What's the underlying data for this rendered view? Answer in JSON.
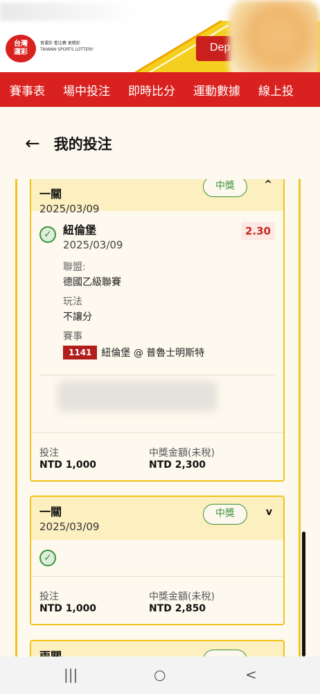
{
  "header": {
    "logo_text": "台灣\n運彩",
    "logo_tagline": "買運彩 看比賽 更精彩\nTAIWAN SPORTS LOTTERY",
    "deposit_label": "Dep"
  },
  "nav": [
    "賽事表",
    "場中投注",
    "即時比分",
    "運動數據",
    "線上投"
  ],
  "page": {
    "back": "←",
    "title": "我的投注"
  },
  "bets": [
    {
      "type": "一關",
      "date": "2025/03/09",
      "status": "中獎",
      "expanded_icon": "^",
      "selection": {
        "team": "紐倫堡",
        "date": "2025/03/09",
        "odds": "2.30",
        "league_label": "聯盟:",
        "league": "德國乙級聯賽",
        "market_label": "玩法",
        "market": "不讓分",
        "event_label": "賽事",
        "event_id": "1141",
        "event_name": "紐倫堡 @ 普魯士明斯特"
      },
      "stake_label": "投注",
      "stake": "NTD 1,000",
      "win_label": "中獎金額(未稅)",
      "win": "NTD 2,300"
    },
    {
      "type": "一關",
      "date": "2025/03/09",
      "status": "中獎",
      "expanded_icon": "v",
      "stake_label": "投注",
      "stake": "NTD 1,000",
      "win_label": "中獎金額(未稅)",
      "win": "NTD 2,850"
    },
    {
      "type": "兩關"
    }
  ],
  "bottom_nav": {
    "recent": "|||",
    "home": "○",
    "back": "<"
  }
}
